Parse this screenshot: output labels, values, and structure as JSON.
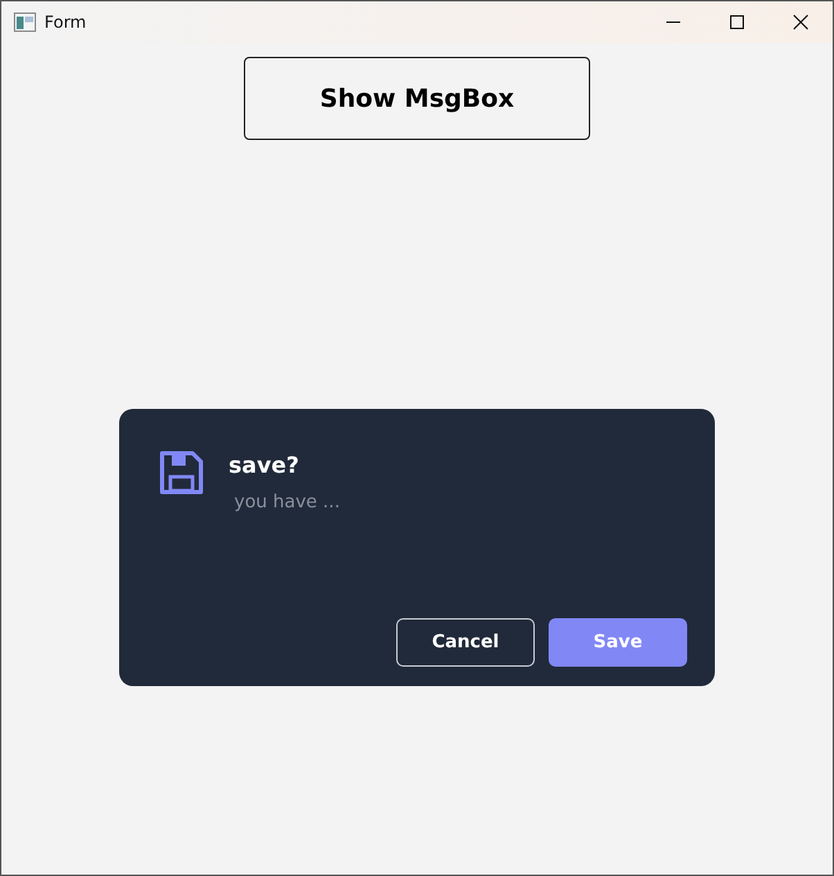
{
  "window": {
    "title": "Form"
  },
  "main_button": {
    "label": "Show MsgBox"
  },
  "dialog": {
    "title": "save?",
    "message": "you have ...",
    "buttons": [
      {
        "label": "Cancel",
        "kind": "outline"
      },
      {
        "label": "Save",
        "kind": "primary"
      }
    ]
  }
}
